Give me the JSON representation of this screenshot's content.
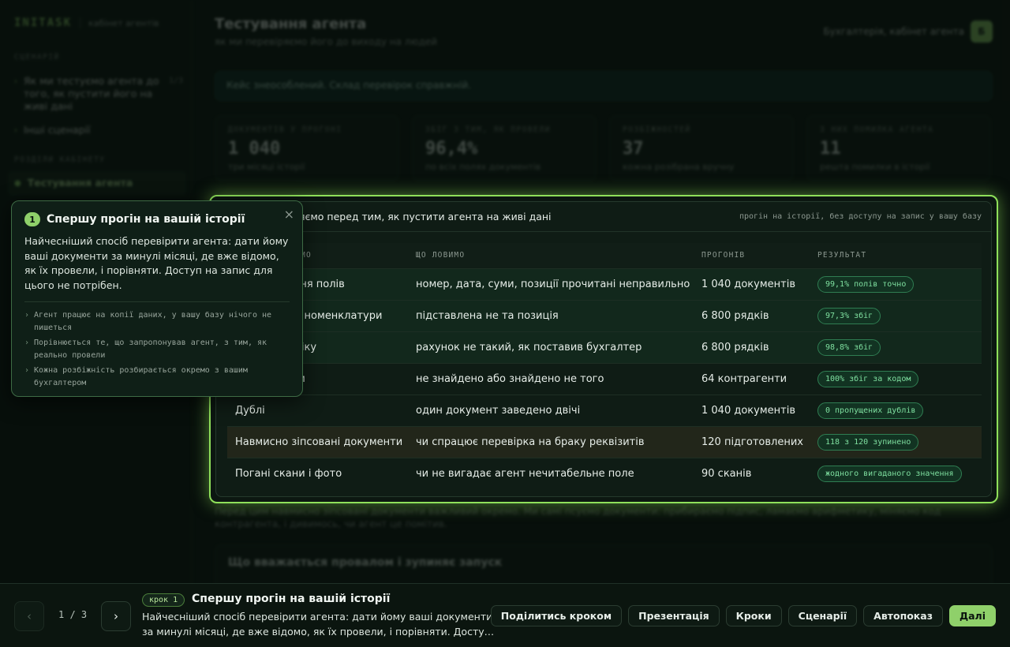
{
  "sidebar": {
    "brand": "INITASK",
    "brand_sub": "кабінет агентів",
    "section_scenario": "СЦЕНАРІЙ",
    "scenario_item": "Як ми тестуємо агента до того, як пустити його на живі дані",
    "scenario_count": "1/3",
    "other_item": "Інші сценарії",
    "section_cabinet": "РОЗДІЛИ КАБІНЕТУ",
    "active_item": "Тестування агента"
  },
  "header": {
    "title": "Тестування агента",
    "subtitle": "як ми перевіряємо його до виходу на людей",
    "account": "Бухгалтерія, кабінет агента",
    "avatar": "Б"
  },
  "notice": "Кейс знеособлений. Склад перевірок справжній.",
  "stats": [
    {
      "label": "ДОКУМЕНТІВ У ПРОГОНІ",
      "value": "1 040",
      "note": "три місяці історії"
    },
    {
      "label": "ЗБІГ З ТИМ, ЯК ПРОВЕЛИ",
      "value": "96,4%",
      "note": "по всіх полях документів"
    },
    {
      "label": "РОЗБІЖНОСТЕЙ",
      "value": "37",
      "note": "кожна розібрана вручну"
    },
    {
      "label": "З НИХ ПОМИЛКА АГЕНТА",
      "value": "11",
      "note": "решта помилки в історії"
    }
  ],
  "card": {
    "title": "Що ми проганяємо перед тим, як пустити агента на живі дані",
    "hint": "прогін на історії, без доступу на запис у вашу базу",
    "columns": [
      "ЩО ПЕРЕВІРЯЄМО",
      "ЩО ЛОВИМО",
      "ПРОГОНІВ",
      "РЕЗУЛЬТАТ"
    ],
    "rows": [
      {
        "check": "Розпізнавання полів",
        "catch": "номер, дата, суми, позиції прочитані неправильно",
        "runs": "1 040 документів",
        "result": "99,1% полів точно"
      },
      {
        "check": "Зіставлення номенклатури",
        "catch": "підставлена не та позиція",
        "runs": "6 800 рядків",
        "result": "97,3% збіг"
      },
      {
        "check": "Рахунок обліку",
        "catch": "рахунок не такий, як поставив бухгалтер",
        "runs": "6 800 рядків",
        "result": "98,8% збіг"
      },
      {
        "check": "Контрагенти",
        "catch": "не знайдено або знайдено не того",
        "runs": "64 контрагенти",
        "result": "100% збіг за кодом"
      },
      {
        "check": "Дублі",
        "catch": "один документ заведено двічі",
        "runs": "1 040 документів",
        "result": "0 пропущених дублів"
      },
      {
        "check": "Навмисно зіпсовані документи",
        "catch": "чи спрацює перевірка на браку реквізитів",
        "runs": "120 підготовлених",
        "result": "118 з 120 зупинено"
      },
      {
        "check": "Погані скани і фото",
        "catch": "чи не вигадає агент нечитабельне поле",
        "runs": "90 сканів",
        "result": "жодного вигаданого значення"
      }
    ]
  },
  "bg_paragraph": "Перед цим навмисно зіпсовані документи важливий окремо. Ми самі псуємо документи: прибираємо підпис, ламаємо арифметику, міняємо код контрагента, і дивимось, чи агент це помітив.",
  "bg_section": "Що вважається провалом і зупиняє запуск",
  "popover": {
    "number": "1",
    "title": "Спершу прогін на вашій історії",
    "body": "Найчесніший спосіб перевірити агента: дати йому ваші документи за минулі місяці, де вже відомо, як їх провели, і порівняти. Доступ на запис для цього не потрібен.",
    "points": [
      "Агент працює на копії даних, у вашу базу нічого не пишеться",
      "Порівнюється те, що запропонував агент, з тим, як реально провели",
      "Кожна розбіжність розбирається окремо з вашим бухгалтером"
    ],
    "close": "×"
  },
  "tour": {
    "prev": "‹",
    "next": "›",
    "counter": "1 / 3",
    "step_badge": "крок 1",
    "step_title": "Спершу прогін на вашій історії",
    "step_text": "Найчесніший спосіб перевірити агента: дати йому ваші документи за минулі місяці, де вже відомо, як їх провели, і порівняти. Досту…",
    "actions": [
      "Поділитись кроком",
      "Презентація",
      "Кроки",
      "Сценарії",
      "Автопоказ",
      "Далі"
    ]
  }
}
